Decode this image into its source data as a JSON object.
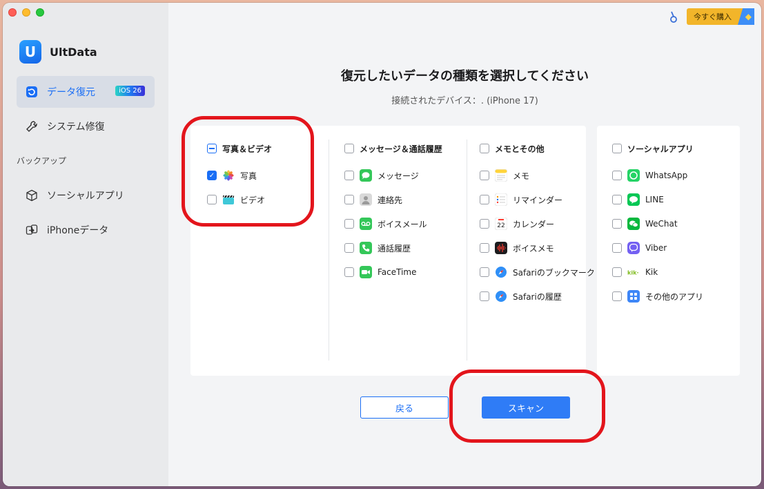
{
  "app": {
    "name": "UltData"
  },
  "sidebar": {
    "items": [
      {
        "label": "データ復元",
        "badge": "iOS 26",
        "active": true,
        "icon": "recover-icon"
      },
      {
        "label": "システム修復",
        "icon": "wrench-icon"
      },
      {
        "label": "ソーシャルアプリ",
        "icon": "cube-icon"
      },
      {
        "label": "iPhoneデータ",
        "icon": "transfer-icon"
      }
    ],
    "section_label": "バックアップ"
  },
  "header": {
    "buy_label": "今すぐ購入"
  },
  "main": {
    "title": "復元したいデータの種類を選択してください",
    "subtitle": "接続されたデバイス：. (iPhone 17)"
  },
  "categories": [
    {
      "header": "写真＆ビデオ",
      "state": "mixed",
      "items": [
        {
          "label": "写真",
          "checked": true,
          "icon": "photos-icon",
          "color": "#ffffff"
        },
        {
          "label": "ビデオ",
          "checked": false,
          "icon": "clapper-icon",
          "color": "#3fc8d8"
        }
      ]
    },
    {
      "header": "メッセージ＆通話履歴",
      "state": "unchecked",
      "items": [
        {
          "label": "メッセージ",
          "checked": false,
          "icon": "messages-icon",
          "color": "#34c759"
        },
        {
          "label": "連絡先",
          "checked": false,
          "icon": "contacts-icon",
          "color": "#9a9a9a"
        },
        {
          "label": "ボイスメール",
          "checked": false,
          "icon": "voicemail-icon",
          "color": "#34c759"
        },
        {
          "label": "通話履歴",
          "checked": false,
          "icon": "phone-icon",
          "color": "#34c759"
        },
        {
          "label": "FaceTime",
          "checked": false,
          "icon": "facetime-icon",
          "color": "#34c759"
        }
      ]
    },
    {
      "header": "メモとその他",
      "state": "unchecked",
      "items": [
        {
          "label": "メモ",
          "checked": false,
          "icon": "notes-icon",
          "color": "#ffd43b"
        },
        {
          "label": "リマインダー",
          "checked": false,
          "icon": "reminders-icon",
          "color": "#ffffff"
        },
        {
          "label": "カレンダー",
          "checked": false,
          "icon": "calendar-icon",
          "color": "#ffffff",
          "icon_text": "22"
        },
        {
          "label": "ボイスメモ",
          "checked": false,
          "icon": "voice-memo-icon",
          "color": "#1c1c1e"
        },
        {
          "label": "Safariのブックマーク",
          "checked": false,
          "icon": "safari-icon",
          "color": "#2f8ff7"
        },
        {
          "label": "Safariの履歴",
          "checked": false,
          "icon": "safari-icon",
          "color": "#2f8ff7"
        }
      ]
    },
    {
      "header": "ソーシャルアプリ",
      "state": "unchecked",
      "items": [
        {
          "label": "WhatsApp",
          "checked": false,
          "icon": "whatsapp-icon",
          "color": "#25d366"
        },
        {
          "label": "LINE",
          "checked": false,
          "icon": "line-icon",
          "color": "#06c755"
        },
        {
          "label": "WeChat",
          "checked": false,
          "icon": "wechat-icon",
          "color": "#09b83e"
        },
        {
          "label": "Viber",
          "checked": false,
          "icon": "viber-icon",
          "color": "#7360f2"
        },
        {
          "label": "Kik",
          "checked": false,
          "icon": "kik-icon",
          "color": "#82bc23",
          "icon_text": "kik·"
        },
        {
          "label": "その他のアプリ",
          "checked": false,
          "icon": "apps-grid-icon",
          "color": "#3d86f7"
        }
      ]
    }
  ],
  "actions": {
    "back_label": "戻る",
    "scan_label": "スキャン"
  },
  "colors": {
    "accent": "#1a6ef5",
    "annotation": "#e3151c"
  }
}
